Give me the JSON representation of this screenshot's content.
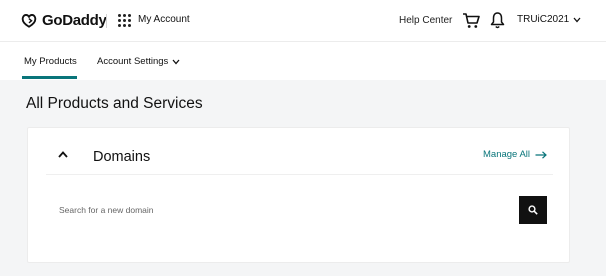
{
  "header": {
    "brand": "GoDaddy",
    "product": "My Account",
    "help": "Help Center",
    "user": "TRUiC2021"
  },
  "nav": {
    "tabs": [
      {
        "label": "My Products",
        "active": true
      },
      {
        "label": "Account Settings",
        "active": false
      }
    ]
  },
  "main": {
    "title": "All Products and Services",
    "card": {
      "title": "Domains",
      "manage_label": "Manage All",
      "search_placeholder": "Search for a new domain"
    }
  },
  "colors": {
    "accent": "#09757a",
    "button_bg": "#111111",
    "page_bg": "#f4f5f6"
  },
  "icons": [
    "godaddy-logo-icon",
    "apps-grid-icon",
    "cart-icon",
    "bell-icon",
    "chevron-down-icon",
    "chevron-up-icon",
    "arrow-right-icon",
    "search-icon"
  ]
}
